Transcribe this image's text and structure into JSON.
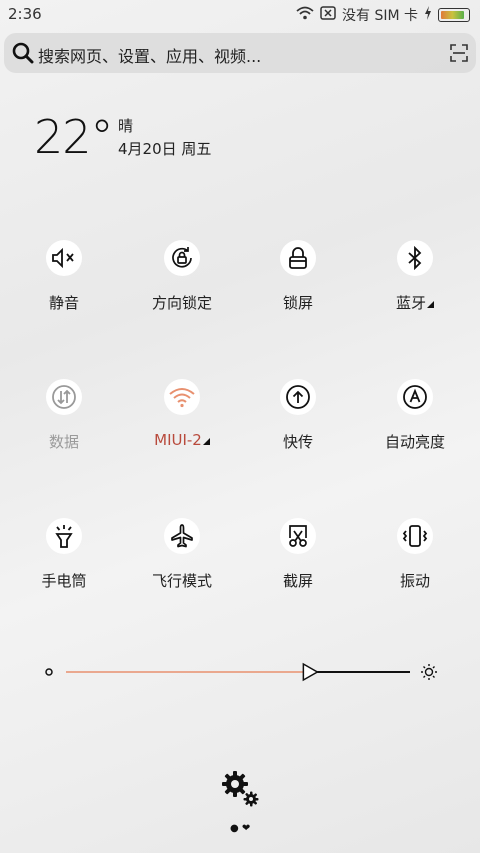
{
  "status_bar": {
    "time": "2:36",
    "carrier": "没有 SIM 卡",
    "icons": [
      "wifi-icon",
      "no-sim-icon",
      "charging-bolt-icon",
      "battery-icon"
    ],
    "battery_level": 0.9
  },
  "search": {
    "placeholder": "搜索网页、设置、应用、视频...",
    "icons": [
      "search-icon",
      "scan-icon"
    ]
  },
  "weather": {
    "temperature": "22°",
    "condition": "晴",
    "date": "4月20日 周五"
  },
  "toggles": [
    {
      "label": "静音",
      "icon": "mute-icon",
      "state": "on"
    },
    {
      "label": "方向锁定",
      "icon": "rotation-lock-icon",
      "state": "on"
    },
    {
      "label": "锁屏",
      "icon": "lock-icon",
      "state": "on"
    },
    {
      "label": "蓝牙",
      "icon": "bluetooth-icon",
      "state": "on"
    },
    {
      "label": "数据",
      "icon": "mobile-data-icon",
      "state": "off"
    },
    {
      "label": "MIUI-2",
      "icon": "wifi-icon",
      "state": "active"
    },
    {
      "label": "快传",
      "icon": "quick-transfer-icon",
      "state": "on"
    },
    {
      "label": "自动亮度",
      "icon": "auto-brightness-icon",
      "state": "on"
    },
    {
      "label": "手电筒",
      "icon": "flashlight-icon",
      "state": "on"
    },
    {
      "label": "飞行模式",
      "icon": "airplane-icon",
      "state": "on"
    },
    {
      "label": "截屏",
      "icon": "screenshot-icon",
      "state": "on"
    },
    {
      "label": "振动",
      "icon": "vibrate-icon",
      "state": "on"
    }
  ],
  "brightness": {
    "level": 0.69
  },
  "colors": {
    "accent": "#e8906f",
    "active_label": "#b84a3c"
  }
}
